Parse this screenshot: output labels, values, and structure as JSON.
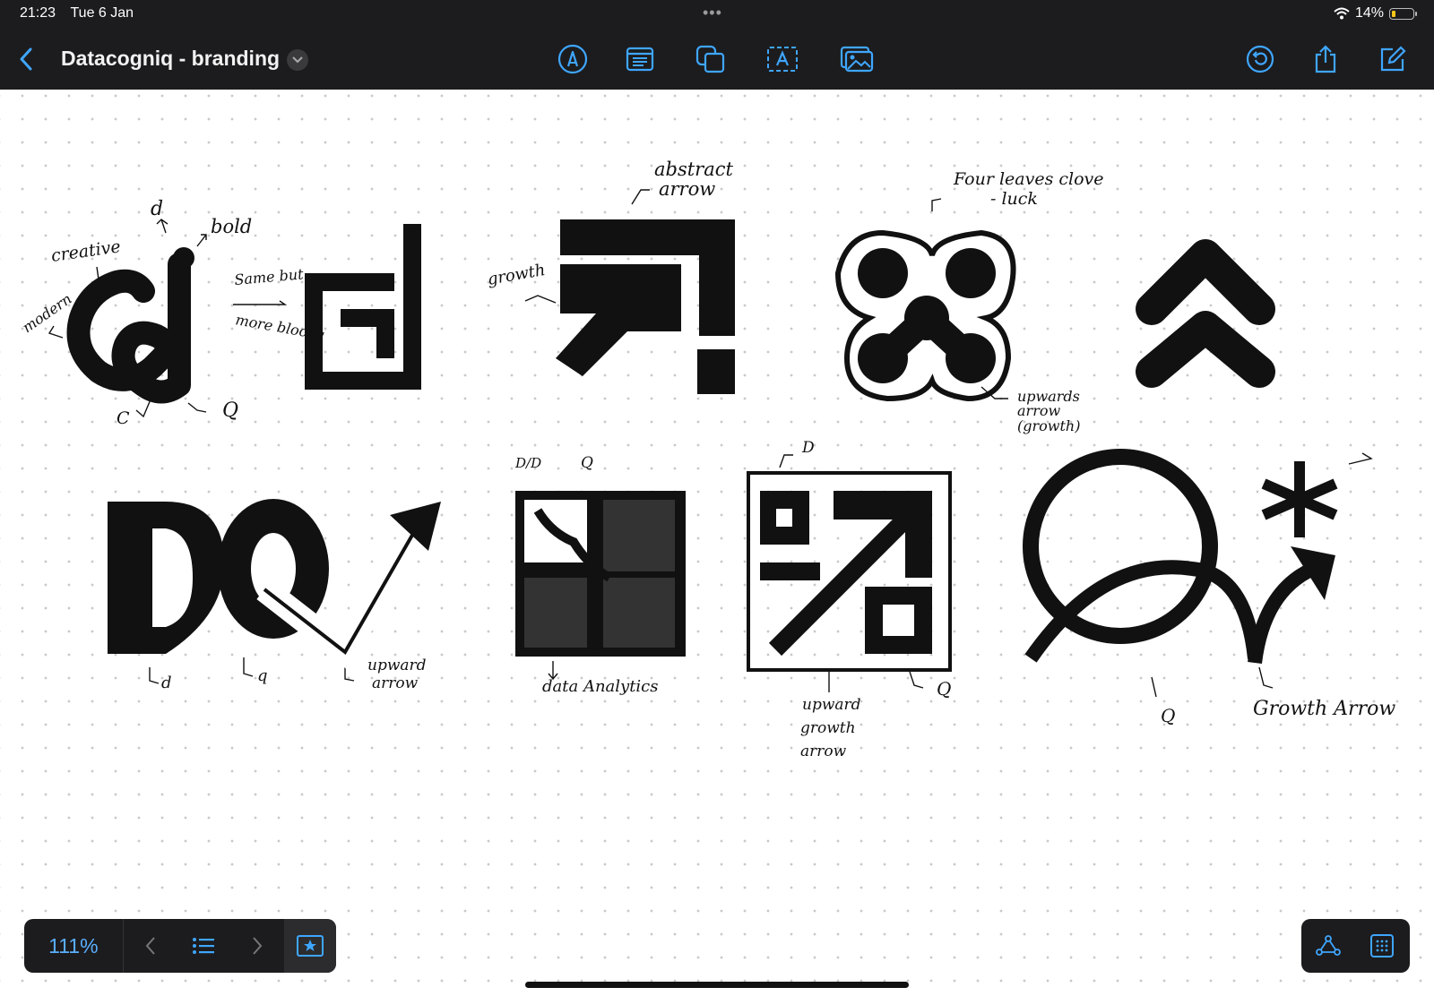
{
  "status_bar": {
    "time": "21:23",
    "date": "Tue 6 Jan",
    "battery": "14%"
  },
  "header": {
    "back_icon": "chevron-left-icon",
    "title": "Datacogniq - branding"
  },
  "toolbar": {
    "tools": [
      "pen-icon",
      "text-box-icon",
      "shapes-icon",
      "text-frame-icon",
      "image-icon"
    ],
    "right": [
      "undo-icon",
      "share-icon",
      "edit-icon"
    ]
  },
  "colors": {
    "accent": "#3fa6ff",
    "bar": "#1c1c1e",
    "ink": "#111111"
  },
  "bottom_bar": {
    "zoom": "111%",
    "right_icons": [
      "shape-recognition-icon",
      "grid-icon"
    ]
  },
  "annotations": {
    "a1": "d",
    "a2": "bold",
    "a3": "creative",
    "a4": "modern",
    "a5": "C",
    "a6": "Q",
    "a7": "Same but",
    "a8": "more blocky",
    "a9": "abstract",
    "a10": "arrow",
    "a11": "growth",
    "a12": "Four leaves clove",
    "a13": "- luck",
    "a14": "upwards",
    "a15": "arrow",
    "a16": "(growth)",
    "a17": "d",
    "a18": "q",
    "a19": "upward",
    "a20": "arrow",
    "a21": "D/D",
    "a22": "Q",
    "a23": "data Analytics",
    "a24": "D",
    "a25": "upward",
    "a26": "growth",
    "a27": "arrow",
    "a28": "Q",
    "a29": "Q",
    "a30": "Growth Arrow"
  }
}
